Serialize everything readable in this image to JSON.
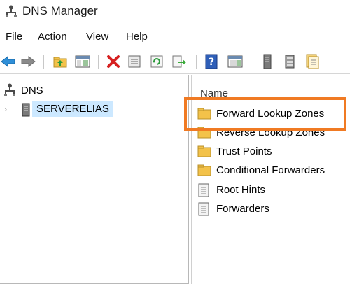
{
  "window": {
    "title": "DNS Manager"
  },
  "menu": [
    "File",
    "Action",
    "View",
    "Help"
  ],
  "toolbar": {
    "buttons": [
      "back-arrow-icon",
      "forward-arrow-icon",
      "up-folder-icon",
      "show-hide-console-tree-icon",
      "delete-icon",
      "properties-icon",
      "refresh-icon",
      "export-list-icon",
      "help-icon",
      "show-hide-action-pane-icon",
      "server-icon",
      "zone-icon",
      "new-record-icon"
    ]
  },
  "tree": {
    "root_label": "DNS",
    "server_label": "SERVERELIAS"
  },
  "list": {
    "column_header": "Name",
    "items": [
      {
        "label": "Forward Lookup Zones",
        "icon": "folder-icon"
      },
      {
        "label": "Reverse Lookup Zones",
        "icon": "folder-icon"
      },
      {
        "label": "Trust Points",
        "icon": "folder-icon"
      },
      {
        "label": "Conditional Forwarders",
        "icon": "folder-icon"
      },
      {
        "label": "Root Hints",
        "icon": "document-icon"
      },
      {
        "label": "Forwarders",
        "icon": "document-icon"
      }
    ]
  },
  "colors": {
    "highlight": "#f07a23",
    "selection": "#cce8ff"
  }
}
